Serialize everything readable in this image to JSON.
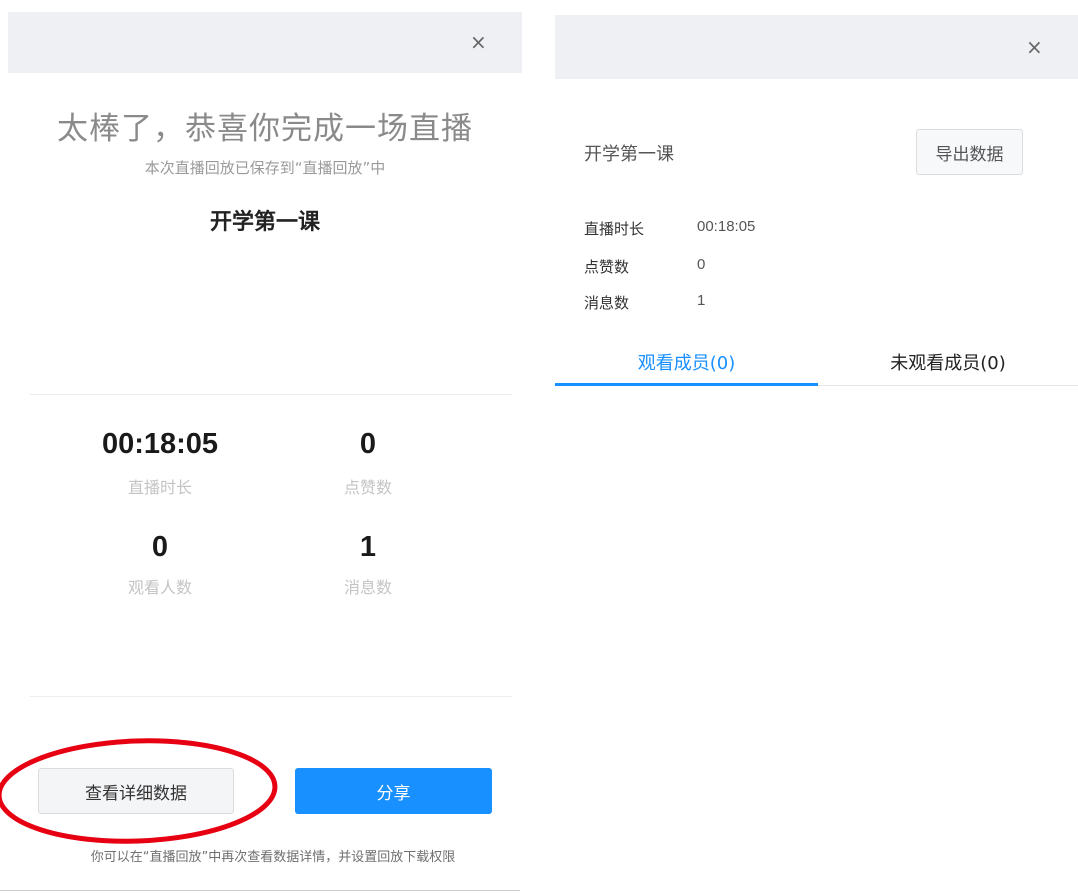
{
  "left_dialog": {
    "close_glyph": "×",
    "headline": "太棒了，恭喜你完成一场直播",
    "subline": "本次直播回放已保存到“直播回放”中",
    "course_title": "开学第一课",
    "stats": {
      "duration": {
        "value": "00:18:05",
        "label": "直播时长"
      },
      "likes": {
        "value": "0",
        "label": "点赞数"
      },
      "viewers": {
        "value": "0",
        "label": "观看人数"
      },
      "messages": {
        "value": "1",
        "label": "消息数"
      }
    },
    "detail_button_label": "查看详细数据",
    "share_button_label": "分享",
    "footnote": "你可以在“直播回放”中再次查看数据详情，并设置回放下载权限",
    "annotation_color": "#e60012"
  },
  "right_dialog": {
    "close_glyph": "×",
    "course_title": "开学第一课",
    "export_button_label": "导出数据",
    "info": [
      {
        "label": "直播时长",
        "value": "00:18:05"
      },
      {
        "label": "点赞数",
        "value": "0"
      },
      {
        "label": "消息数",
        "value": "1"
      }
    ],
    "tabs": [
      {
        "label": "观看成员(0)",
        "active": true
      },
      {
        "label": "未观看成员(0)",
        "active": false
      }
    ]
  },
  "colors": {
    "accent": "#1890ff",
    "header_bg": "#eef0f3"
  }
}
